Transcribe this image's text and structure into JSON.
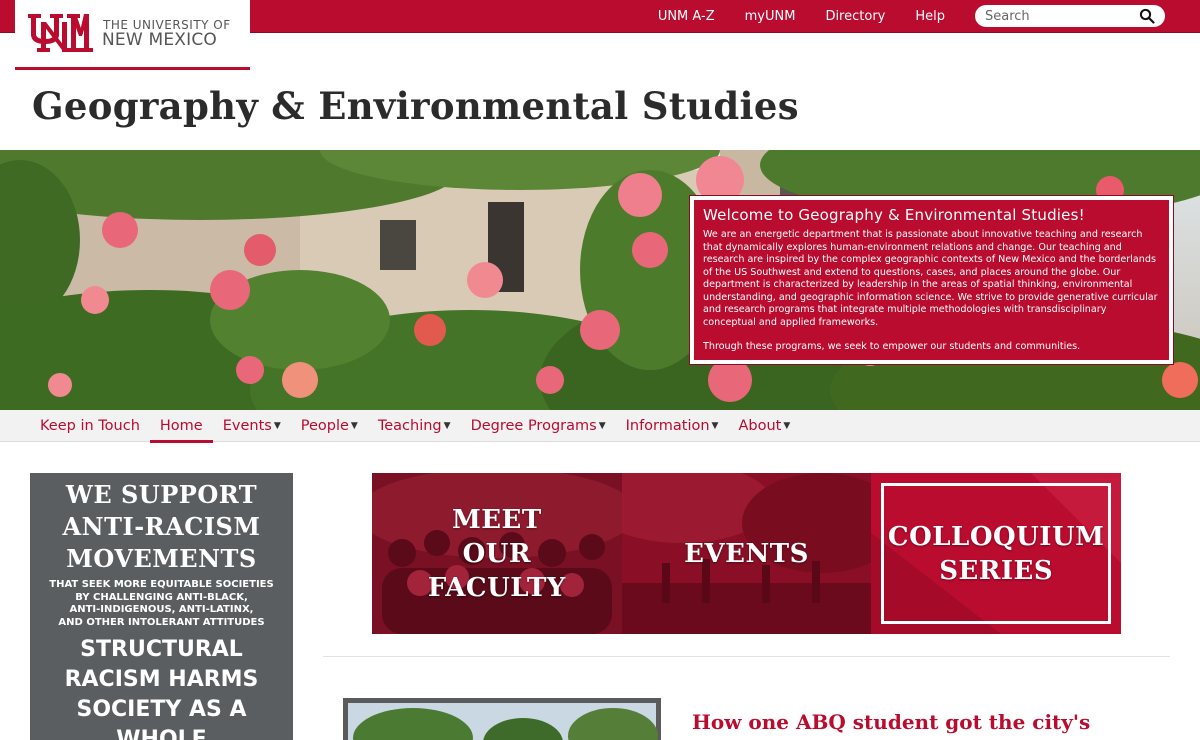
{
  "header": {
    "logo_line1": "THE UNIVERSITY OF",
    "logo_line2": "NEW MEXICO",
    "links": [
      "UNM A-Z",
      "myUNM",
      "Directory",
      "Help"
    ],
    "search_placeholder": "Search"
  },
  "site_title": "Geography & Environmental Studies",
  "welcome": {
    "heading": "Welcome to Geography & Environmental Studies!",
    "body": "We are an energetic department that is passionate about innovative teaching and research that dynamically explores human-environment relations and change. Our teaching and research are inspired by the complex geographic contexts of New Mexico and the borderlands of the US Southwest and extend to questions, cases, and places around the globe. Our department is characterized by leadership in the areas of spatial thinking, environmental understanding, and geographic information science. We strive to provide generative curricular and research programs that integrate multiple methodologies with transdisciplinary conceptual and applied frameworks.",
    "closing": "Through these programs, we seek to empower our students and communities."
  },
  "nav": {
    "items": [
      {
        "label": "Keep in Touch",
        "dropdown": false
      },
      {
        "label": "Home",
        "dropdown": false,
        "active": true
      },
      {
        "label": "Events",
        "dropdown": true
      },
      {
        "label": "People",
        "dropdown": true
      },
      {
        "label": "Teaching",
        "dropdown": true
      },
      {
        "label": "Degree Programs",
        "dropdown": true
      },
      {
        "label": "Information",
        "dropdown": true
      },
      {
        "label": "About",
        "dropdown": true
      }
    ]
  },
  "poster": {
    "headline": [
      "WE SUPPORT",
      "ANTI-RACISM",
      "MOVEMENTS"
    ],
    "subtext": [
      "THAT SEEK MORE EQUITABLE SOCIETIES",
      "BY CHALLENGING ANTI-BLACK,",
      "ANTI-INDIGENOUS, ANTI-LATINX,",
      "AND OTHER INTOLERANT ATTITUDES"
    ],
    "headline2": [
      "STRUCTURAL",
      "RACISM HARMS",
      "SOCIETY AS A",
      "WHOLE"
    ]
  },
  "tiles": [
    {
      "label": [
        "MEET",
        "OUR",
        "FACULTY"
      ]
    },
    {
      "label": [
        "EVENTS"
      ]
    },
    {
      "label": [
        "COLLOQUIUM",
        "SERIES"
      ]
    }
  ],
  "story": {
    "title": "How one ABQ student got the city's attention on urban heat in a safe..."
  },
  "colors": {
    "brand_red": "#ba0c2f",
    "poster_gray": "#5b5e61",
    "title_dark": "#2b2b2b"
  }
}
